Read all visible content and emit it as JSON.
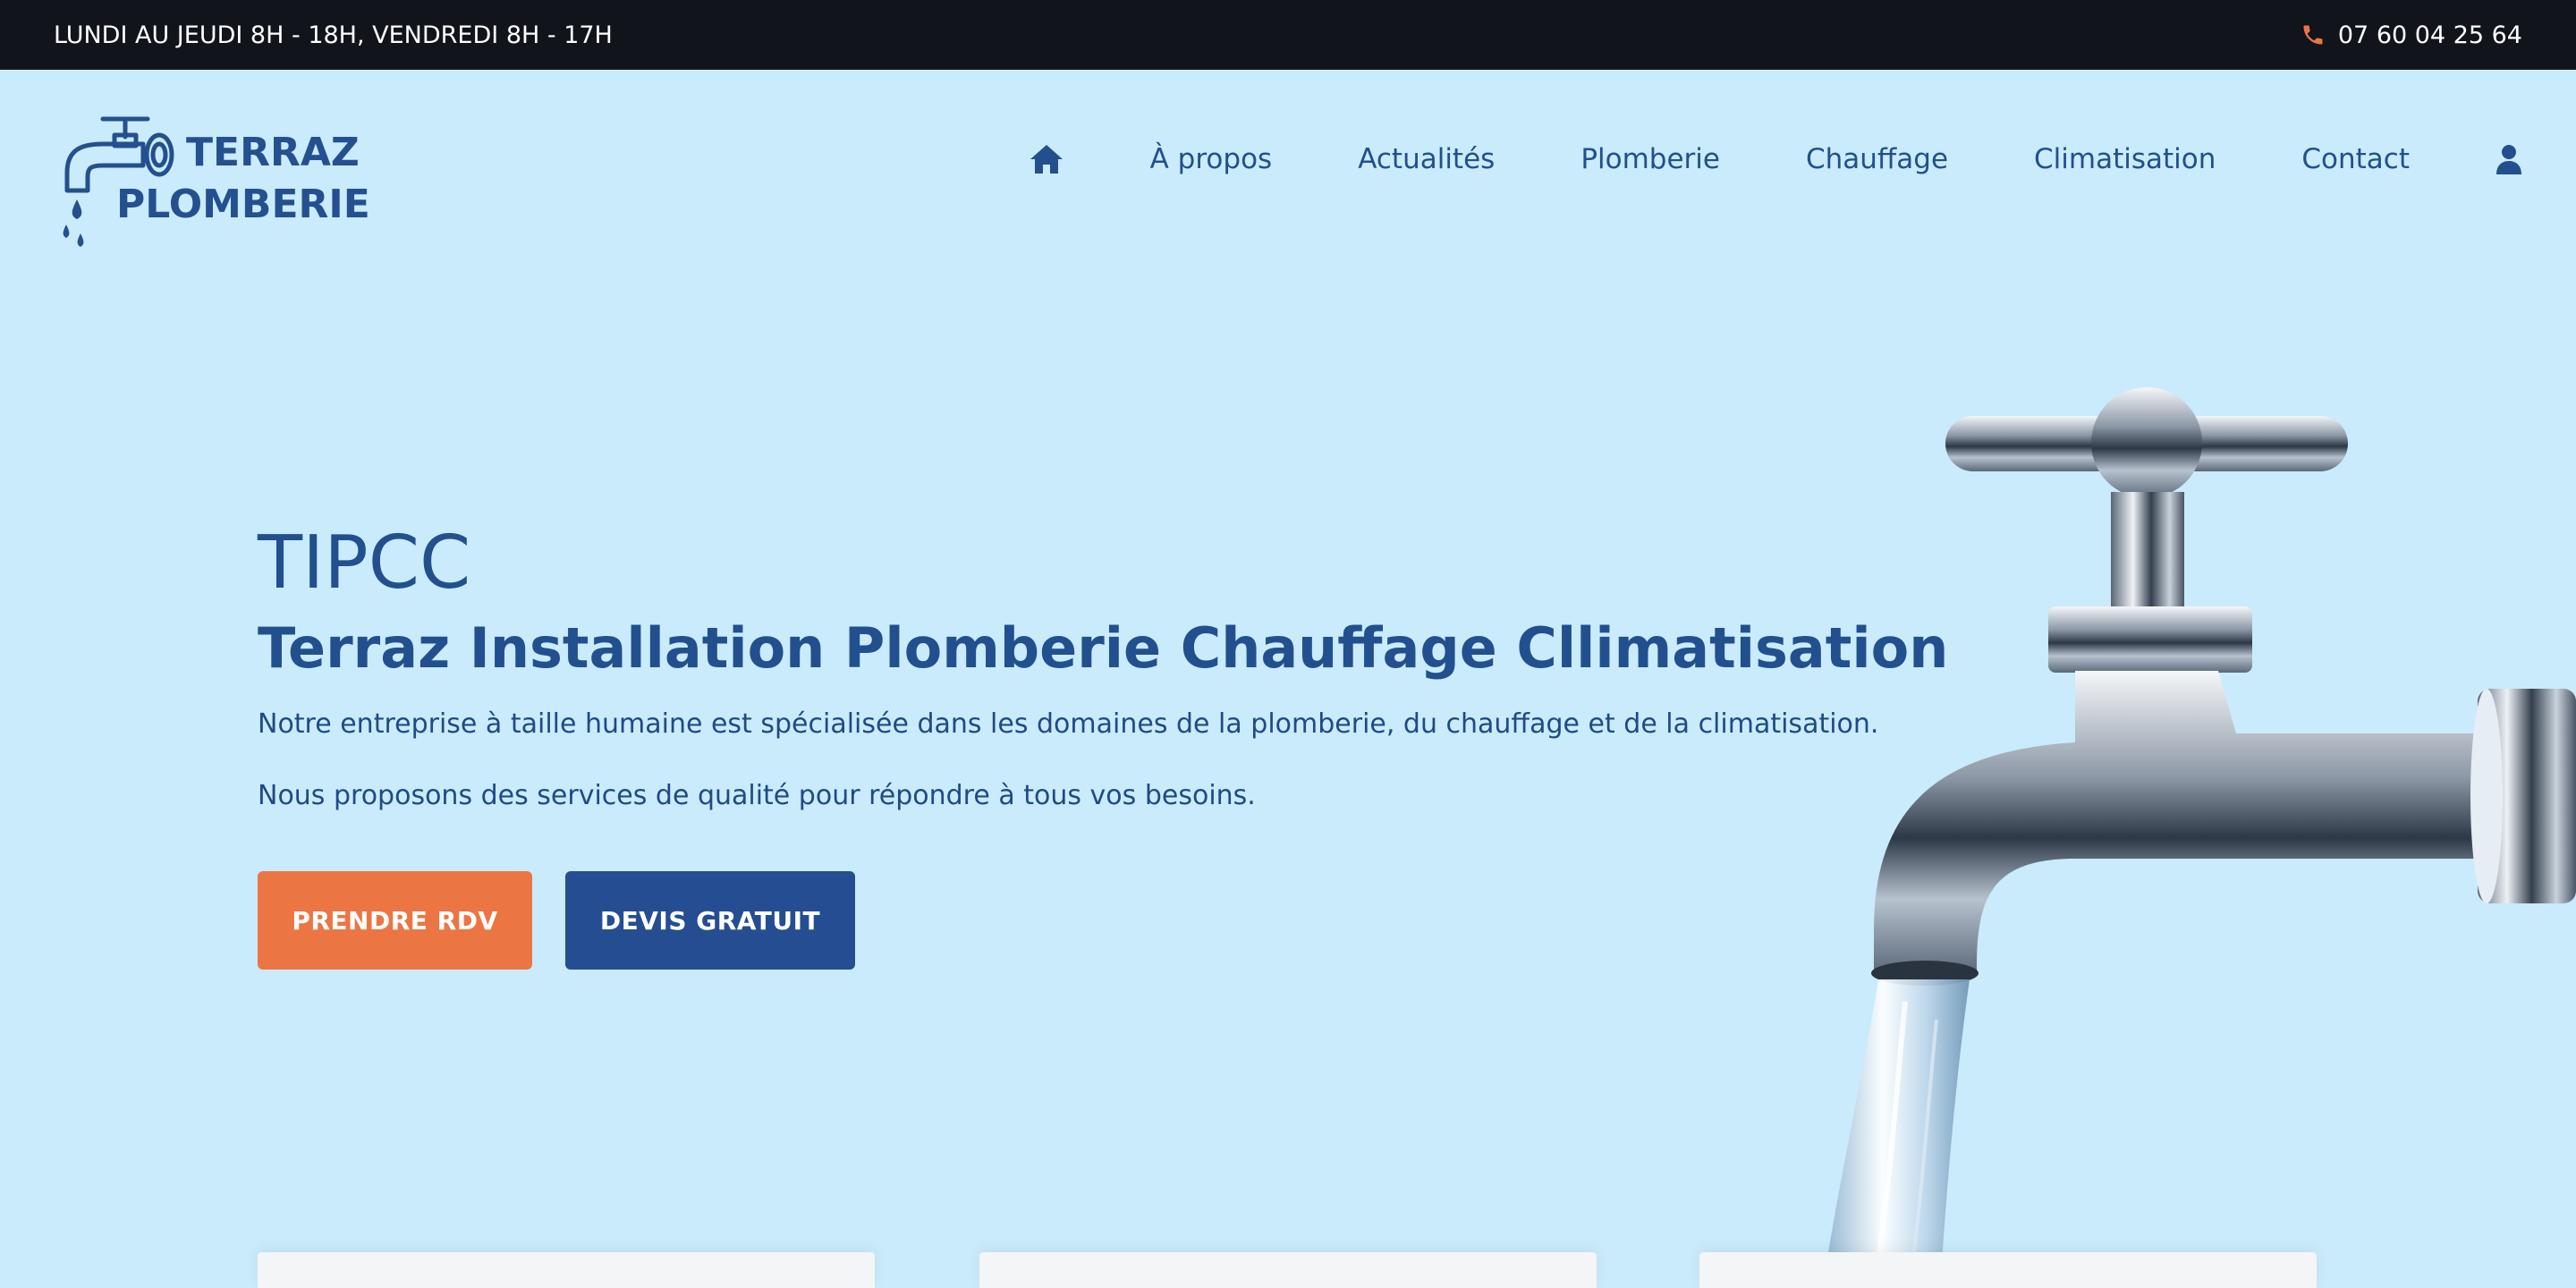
{
  "topbar": {
    "hours": "LUNDI AU JEUDI 8H - 18H, VENDREDI 8H - 17H",
    "phone": "07 60 04 25 64",
    "phone_icon": "phone-icon",
    "phone_icon_color": "#ec7544"
  },
  "logo": {
    "line1": "TERRAZ",
    "line2": "PLOMBERIE"
  },
  "nav": {
    "home_icon": "home-icon",
    "items": [
      {
        "label": "À propos"
      },
      {
        "label": "Actualités"
      },
      {
        "label": "Plomberie"
      },
      {
        "label": "Chauffage"
      },
      {
        "label": "Climatisation"
      },
      {
        "label": "Contact"
      }
    ],
    "user_icon": "user-icon"
  },
  "hero": {
    "title": "TIPCC",
    "subtitle": "Terraz Installation Plomberie Chauffage Cllimatisation",
    "paragraph1": "Notre entreprise à taille humaine est spécialisée dans les domaines de la plomberie, du chauffage et de la climatisation.",
    "paragraph2": "Nous proposons des services de qualité pour répondre à tous vos besoins.",
    "button_rdv": "PRENDRE RDV",
    "button_devis": "DEVIS GRATUIT"
  },
  "colors": {
    "background": "#c9ebfb",
    "topbar": "#12141c",
    "primary": "#22508e",
    "accent": "#ec7544",
    "button_secondary": "#254d92"
  }
}
